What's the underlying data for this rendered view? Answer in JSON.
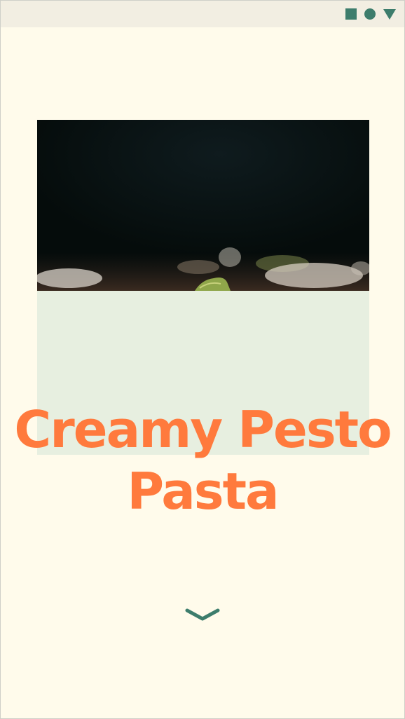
{
  "recipe": {
    "title": "Creamy Pesto Pasta",
    "image_alt": "pesto-pasta-photo"
  },
  "status_bar": {
    "icons": [
      "square-icon",
      "circle-icon",
      "triangle-icon"
    ]
  },
  "scroll_indicator": {
    "icon": "chevron-down-icon"
  },
  "colors": {
    "background": "#fffbeb",
    "status_bar": "#f2eee2",
    "accent_green": "#3d7d6c",
    "title_orange": "#ff7a3d",
    "panel": "#e7efe0"
  }
}
